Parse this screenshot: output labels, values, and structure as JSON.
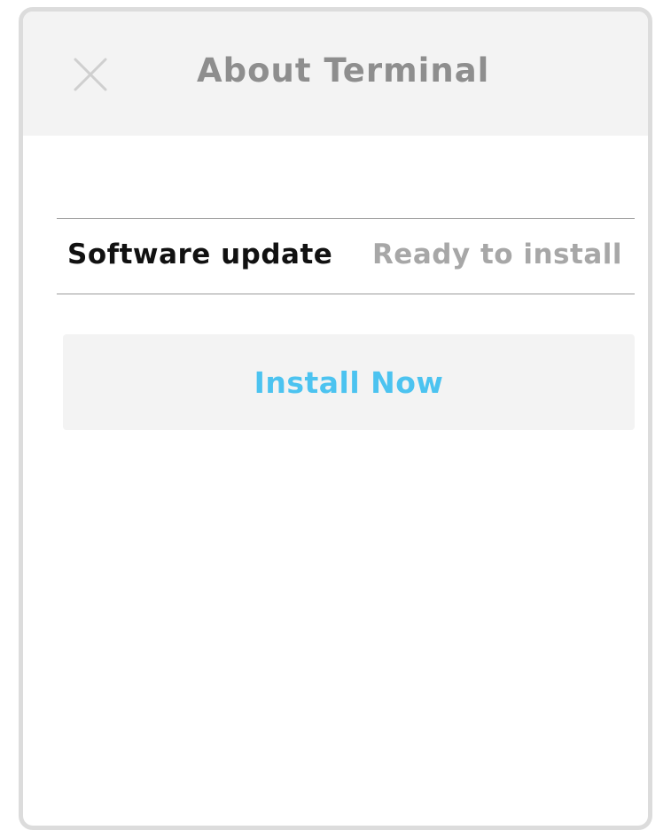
{
  "dialog": {
    "title": "About Terminal",
    "close_icon": "close-icon"
  },
  "update_row": {
    "label": "Software update",
    "status": "Ready to install"
  },
  "install_button": {
    "label": "Install Now"
  },
  "colors": {
    "accent": "#4cc3f0",
    "titlebar_bg": "#f3f3f3",
    "title_text": "#8e8e8e",
    "status_text": "#a7a7a7"
  }
}
